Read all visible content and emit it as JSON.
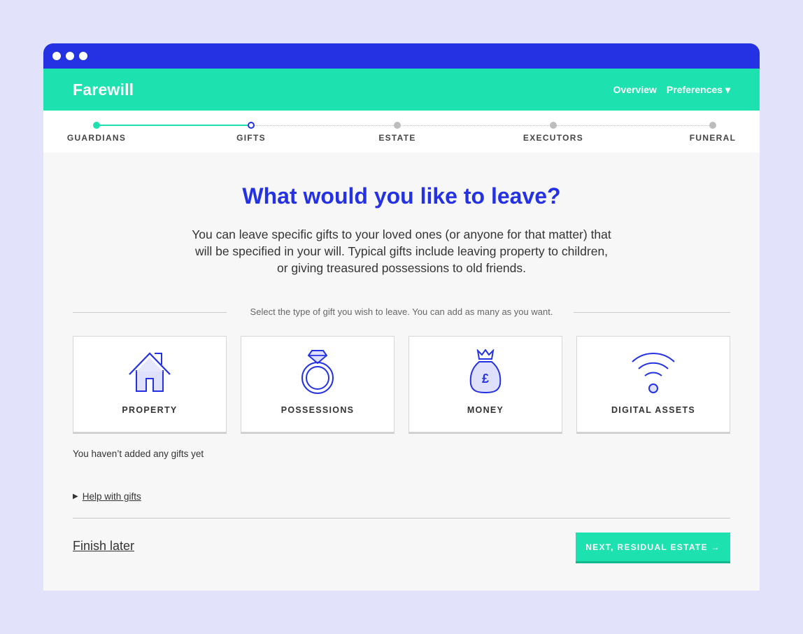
{
  "nav": {
    "brand": "Farewill",
    "overview": "Overview",
    "preferences": "Preferences ▾"
  },
  "steps": [
    {
      "label": "GUARDIANS",
      "state": "done"
    },
    {
      "label": "GIFTS",
      "state": "current"
    },
    {
      "label": "ESTATE",
      "state": "todo"
    },
    {
      "label": "EXECUTORS",
      "state": "todo"
    },
    {
      "label": "FUNERAL",
      "state": "todo"
    }
  ],
  "main": {
    "heading": "What would you like to leave?",
    "intro": "You can leave specific gifts to your loved ones (or anyone for that matter) that will be specified in your will. Typical gifts include leaving property to children, or giving treasured possessions to old friends.",
    "divider_text": "Select the type of gift you wish to leave. You can add as many as you want.",
    "cards": [
      {
        "label": "PROPERTY",
        "icon": "house-icon"
      },
      {
        "label": "POSSESSIONS",
        "icon": "ring-icon"
      },
      {
        "label": "MONEY",
        "icon": "money-bag-icon"
      },
      {
        "label": "DIGITAL ASSETS",
        "icon": "wifi-icon"
      }
    ],
    "empty_note": "You haven’t added any gifts yet",
    "help_link": "Help with gifts"
  },
  "footer": {
    "finish_later": "Finish later",
    "next_button": "NEXT, RESIDUAL ESTATE →"
  },
  "colors": {
    "primary": "#2432e3",
    "accent": "#1de2b0",
    "background": "#e2e2fa"
  }
}
